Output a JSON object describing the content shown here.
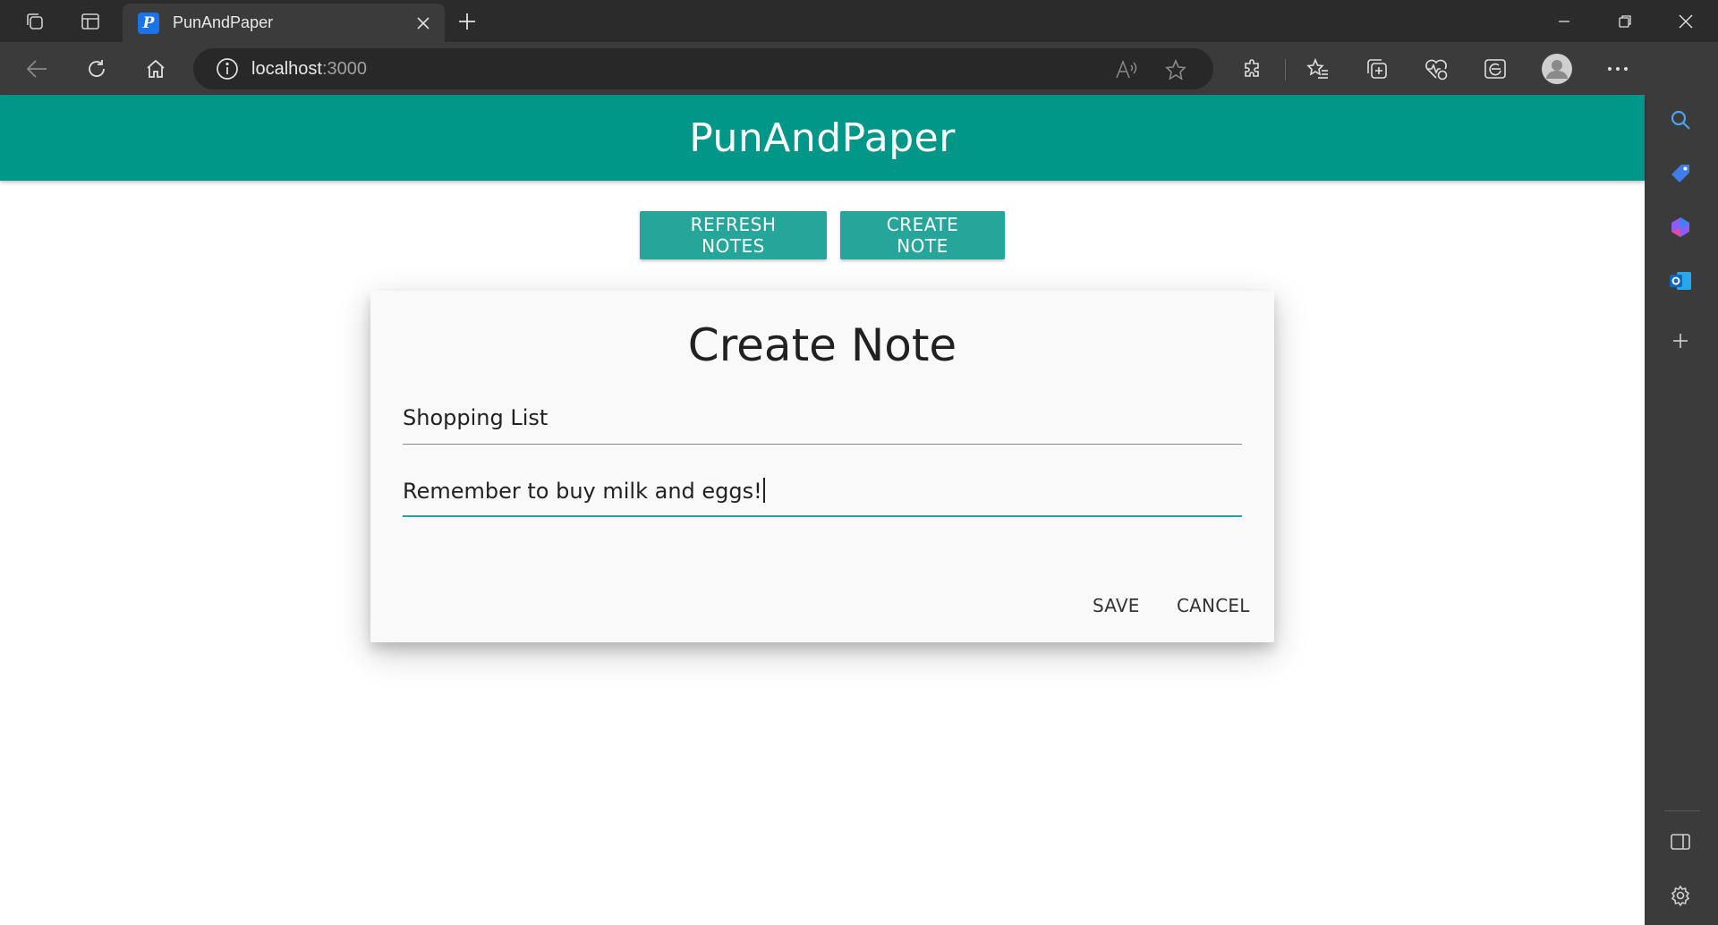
{
  "browser": {
    "tab": {
      "title": "PunAndPaper",
      "favicon_letter": "P"
    },
    "address": {
      "host": "localhost",
      "port": ":3000"
    }
  },
  "app": {
    "title": "PunAndPaper",
    "actions": {
      "refresh_label": "REFRESH NOTES",
      "create_label": "CREATE NOTE"
    }
  },
  "dialog": {
    "title": "Create Note",
    "note_title_value": "Shopping List",
    "note_body_value": "Remember to buy milk and eggs!",
    "save_label": "SAVE",
    "cancel_label": "CANCEL"
  },
  "colors": {
    "appbar": "#009688",
    "button": "#26a69a",
    "accent_underline": "#26a69a"
  }
}
